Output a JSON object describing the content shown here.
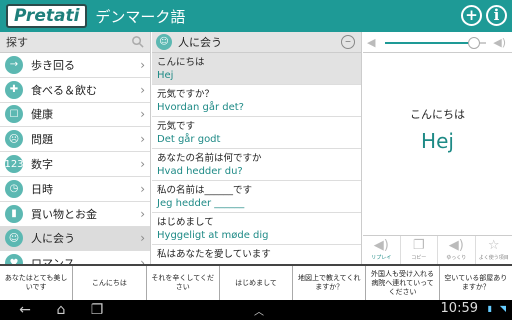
{
  "app": {
    "logo": "Pretati",
    "title": "デンマーク語"
  },
  "search": {
    "label": "探す"
  },
  "categories": [
    {
      "label": "歩き回る",
      "icon": "→"
    },
    {
      "label": "食べる＆飲む",
      "icon": "✚"
    },
    {
      "label": "健康",
      "icon": "☐"
    },
    {
      "label": "問題",
      "icon": "☹"
    },
    {
      "label": "数字",
      "icon": "123"
    },
    {
      "label": "日時",
      "icon": "◷"
    },
    {
      "label": "買い物とお金",
      "icon": "▮"
    },
    {
      "label": "人に会う",
      "icon": "☺",
      "active": true
    },
    {
      "label": "ロマンス",
      "icon": "♥"
    }
  ],
  "phrase_section": {
    "title": "人に会う"
  },
  "phrases": [
    {
      "jp": "こんにちは",
      "da": "Hej",
      "selected": true
    },
    {
      "jp": "元気ですか？",
      "da": "Hvordan går det?"
    },
    {
      "jp": "元気です",
      "da": "Det går godt"
    },
    {
      "jp": "あなたの名前は何ですか",
      "da": "Hvad hedder du?"
    },
    {
      "jp": "私の名前は______です",
      "da": "Jeg hedder ______"
    },
    {
      "jp": "はじめまして",
      "da": "Hyggeligt at møde dig"
    },
    {
      "jp": "私はあなたを愛しています",
      "da": ""
    }
  ],
  "detail": {
    "jp": "こんにちは",
    "da": "Hej",
    "volume": 0.88
  },
  "actions": [
    {
      "label": "リプレイ",
      "icon": "speaker-icon"
    },
    {
      "label": "コピー",
      "icon": "copy-icon"
    },
    {
      "label": "ゆっくり",
      "icon": "slow-icon"
    },
    {
      "label": "よく使う項目",
      "icon": "star-icon"
    }
  ],
  "suggestions": [
    "あなたはとても美しいです",
    "こんにちは",
    "それを辛くしてください",
    "はじめまして",
    "地図上で教えてくれますか？",
    "外国人も受け入れる病院へ連れていってください",
    "空いている部屋ありますか？"
  ],
  "system": {
    "time": "10:59"
  },
  "colors": {
    "accent": "#1e9a96",
    "text_accent": "#1e8a86"
  }
}
